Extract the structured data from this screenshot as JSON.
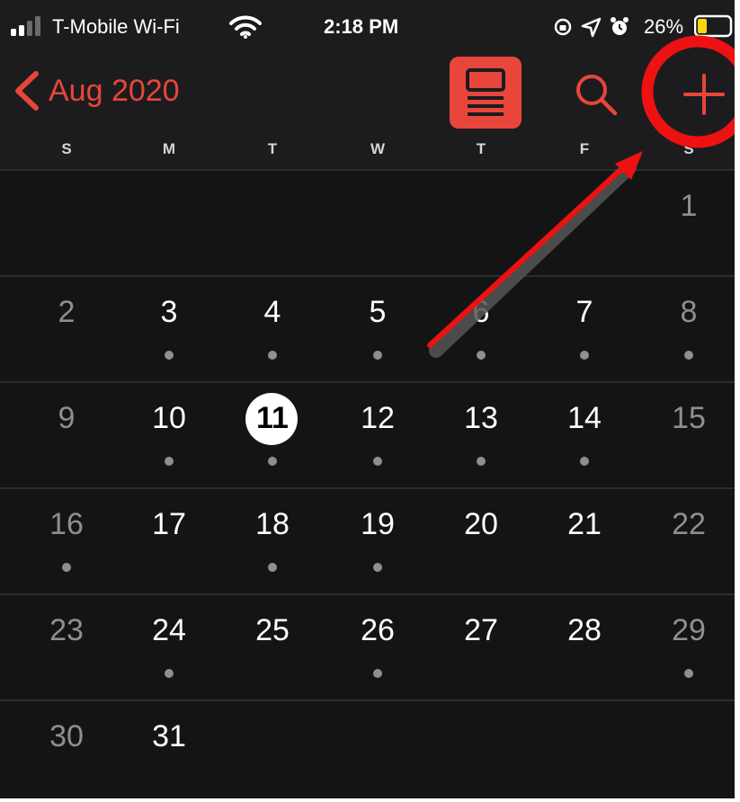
{
  "status_bar": {
    "carrier": "T-Mobile Wi-Fi",
    "time": "2:18 PM",
    "battery_percent": "26%",
    "icons": [
      "signal-icon",
      "wifi-icon",
      "screen-lock-icon",
      "location-icon",
      "alarm-icon",
      "battery-icon"
    ]
  },
  "nav": {
    "back_label": "Aug 2020",
    "accent_color": "#e8463a",
    "buttons": [
      "list-view-button",
      "search-button",
      "add-button"
    ]
  },
  "weekdays": [
    "S",
    "M",
    "T",
    "W",
    "T",
    "F",
    "S"
  ],
  "weeks": [
    [
      {
        "day": ""
      },
      {
        "day": ""
      },
      {
        "day": ""
      },
      {
        "day": ""
      },
      {
        "day": ""
      },
      {
        "day": ""
      },
      {
        "day": "1",
        "event": false
      }
    ],
    [
      {
        "day": "2",
        "event": false
      },
      {
        "day": "3",
        "event": true
      },
      {
        "day": "4",
        "event": true
      },
      {
        "day": "5",
        "event": true
      },
      {
        "day": "6",
        "event": true
      },
      {
        "day": "7",
        "event": true
      },
      {
        "day": "8",
        "event": true
      }
    ],
    [
      {
        "day": "9",
        "event": false
      },
      {
        "day": "10",
        "event": true
      },
      {
        "day": "11",
        "event": true,
        "today": true
      },
      {
        "day": "12",
        "event": true
      },
      {
        "day": "13",
        "event": true
      },
      {
        "day": "14",
        "event": true
      },
      {
        "day": "15",
        "event": false
      }
    ],
    [
      {
        "day": "16",
        "event": true
      },
      {
        "day": "17",
        "event": false
      },
      {
        "day": "18",
        "event": true
      },
      {
        "day": "19",
        "event": true
      },
      {
        "day": "20",
        "event": false
      },
      {
        "day": "21",
        "event": false
      },
      {
        "day": "22",
        "event": false
      }
    ],
    [
      {
        "day": "23",
        "event": false
      },
      {
        "day": "24",
        "event": true
      },
      {
        "day": "25",
        "event": false
      },
      {
        "day": "26",
        "event": true
      },
      {
        "day": "27",
        "event": false
      },
      {
        "day": "28",
        "event": false
      },
      {
        "day": "29",
        "event": true
      }
    ],
    [
      {
        "day": "30",
        "event": false
      },
      {
        "day": "31",
        "event": false
      },
      {
        "day": ""
      },
      {
        "day": ""
      },
      {
        "day": ""
      },
      {
        "day": ""
      },
      {
        "day": ""
      }
    ]
  ],
  "annotation": {
    "color": "#ee1111",
    "shapes": [
      "highlight-circle",
      "pointer-arrow"
    ]
  }
}
